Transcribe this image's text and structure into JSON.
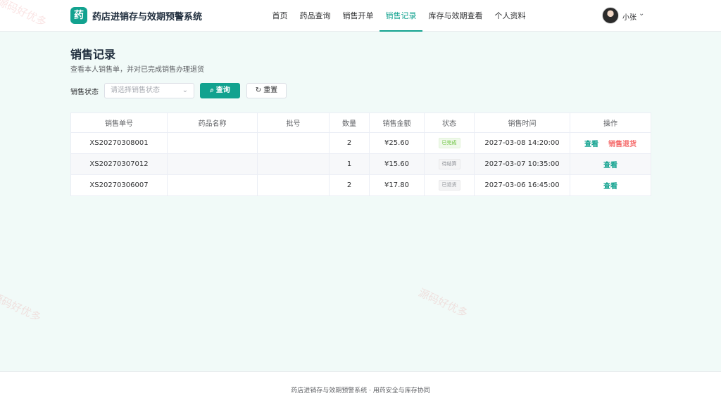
{
  "header": {
    "logo_char": "药",
    "app_title": "药店进销存与效期预警系统",
    "nav": [
      {
        "label": "首页"
      },
      {
        "label": "药品查询"
      },
      {
        "label": "销售开单"
      },
      {
        "label": "销售记录",
        "active": true
      },
      {
        "label": "库存与效期查看"
      },
      {
        "label": "个人资料"
      }
    ],
    "user": {
      "name": "小张",
      "chevron": "chevron-down-icon"
    }
  },
  "page": {
    "title": "销售记录",
    "subtitle": "查看本人销售单，并对已完成销售办理退货"
  },
  "filter": {
    "label": "销售状态",
    "select_placeholder": "请选择销售状态",
    "search_label": "查询",
    "reset_label": "重置"
  },
  "table": {
    "columns": [
      "销售单号",
      "药品名称",
      "批号",
      "数量",
      "销售金额",
      "状态",
      "销售时间",
      "操作"
    ],
    "rows": [
      {
        "order_no": "XS20270308001",
        "drug_name": "",
        "batch": "",
        "qty": "2",
        "amount": "¥25.60",
        "status": "已完成",
        "time": "2027-03-08 14:20:00",
        "view": "查看",
        "return": "销售退货"
      },
      {
        "order_no": "XS20270307012",
        "drug_name": "",
        "batch": "",
        "qty": "1",
        "amount": "¥15.60",
        "status": "待结算",
        "time": "2027-03-07 10:35:00",
        "view": "查看"
      },
      {
        "order_no": "XS20270306007",
        "drug_name": "",
        "batch": "",
        "qty": "2",
        "amount": "¥17.80",
        "status": "已退货",
        "time": "2027-03-06 16:45:00",
        "view": "查看"
      }
    ]
  },
  "watermark": "源码好优多",
  "footer": {
    "text": "药店进销存与效期预警系统 · 用药安全与库存协同"
  },
  "colors": {
    "accent": "#12a28f",
    "danger": "#f56c6c",
    "success": "#67c23a"
  }
}
